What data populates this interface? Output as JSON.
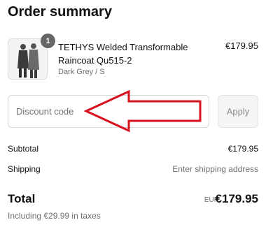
{
  "order": {
    "title": "Order summary"
  },
  "product": {
    "quantity": "1",
    "name": "TETHYS Welded Transformable Raincoat Qu515-2",
    "variant": "Dark Grey / S",
    "price": "€179.95",
    "image_icon": "product-photo-two-models-raincoats"
  },
  "discount": {
    "placeholder": "Discount code",
    "value": "",
    "apply_label": "Apply"
  },
  "annotation": {
    "color": "#d9111f",
    "direction": "left"
  },
  "summary": {
    "subtotal_label": "Subtotal",
    "subtotal_value": "€179.95",
    "shipping_label": "Shipping",
    "shipping_value": "Enter shipping address",
    "total_label": "Total",
    "currency": "EUR",
    "total_value": "€179.95",
    "taxes_note": "Including €29.99 in taxes"
  }
}
